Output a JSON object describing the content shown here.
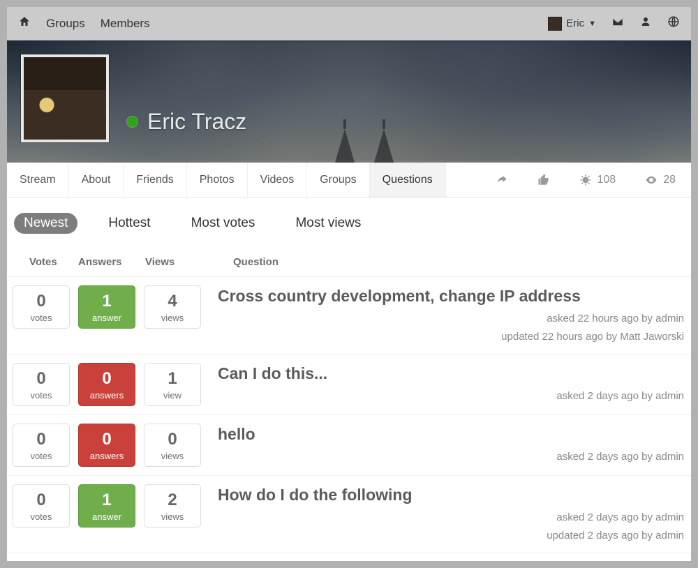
{
  "nav": {
    "groups": "Groups",
    "members": "Members",
    "user": "Eric"
  },
  "profile": {
    "name": "Eric Tracz",
    "tabs": [
      "Stream",
      "About",
      "Friends",
      "Photos",
      "Videos",
      "Groups",
      "Questions"
    ],
    "active_tab_index": 6,
    "stats": {
      "points": "108",
      "views": "28"
    }
  },
  "sort": {
    "options": [
      "Newest",
      "Hottest",
      "Most votes",
      "Most views"
    ],
    "active_index": 0
  },
  "columns": {
    "votes": "Votes",
    "answers": "Answers",
    "views": "Views",
    "question": "Question"
  },
  "questions": [
    {
      "votes": {
        "n": "0",
        "l": "votes"
      },
      "answers": {
        "n": "1",
        "l": "answer",
        "style": "green"
      },
      "views": {
        "n": "4",
        "l": "views"
      },
      "title": "Cross country development, change IP address",
      "meta": [
        "asked 22 hours ago by admin",
        "updated 22 hours ago by Matt Jaworski"
      ]
    },
    {
      "votes": {
        "n": "0",
        "l": "votes"
      },
      "answers": {
        "n": "0",
        "l": "answers",
        "style": "red"
      },
      "views": {
        "n": "1",
        "l": "view"
      },
      "title": "Can I do this...",
      "meta": [
        "asked 2 days ago by admin"
      ]
    },
    {
      "votes": {
        "n": "0",
        "l": "votes"
      },
      "answers": {
        "n": "0",
        "l": "answers",
        "style": "red"
      },
      "views": {
        "n": "0",
        "l": "views"
      },
      "title": "hello",
      "meta": [
        "asked 2 days ago by admin"
      ]
    },
    {
      "votes": {
        "n": "0",
        "l": "votes"
      },
      "answers": {
        "n": "1",
        "l": "answer",
        "style": "green"
      },
      "views": {
        "n": "2",
        "l": "views"
      },
      "title": "How do I do the following",
      "meta": [
        "asked 2 days ago by admin",
        "updated 2 days ago by admin"
      ]
    }
  ]
}
